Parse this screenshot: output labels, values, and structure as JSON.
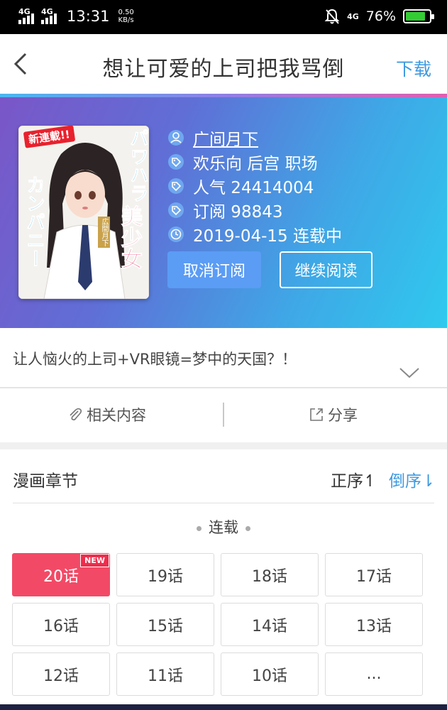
{
  "status": {
    "net1": "4G",
    "net2": "4G",
    "time": "13:31",
    "speed_value": "0.50",
    "speed_unit": "KB/s",
    "net3": "4G",
    "battery_pct": "76%",
    "battery_level": 0.76
  },
  "nav": {
    "title": "想让可爱的上司把我骂倒",
    "action": "下载"
  },
  "info": {
    "author": "广间月下",
    "tags": "欢乐向 后宫 职场",
    "popularity": "人气 24414004",
    "subscribe": "订阅 98843",
    "status_date": "2019-04-15 连载中"
  },
  "buttons": {
    "unsubscribe": "取消订阅",
    "continue": "继续阅读"
  },
  "description": "让人恼火的上司+VR眼镜=梦中的天国？！",
  "actions": {
    "related": "相关内容",
    "share": "分享"
  },
  "chapters": {
    "title": "漫画章节",
    "sort_asc": "正序↿",
    "sort_desc": "倒序⇂",
    "section": "连载",
    "new_badge": "NEW",
    "items": [
      "20话",
      "19话",
      "18话",
      "17话",
      "16话",
      "15话",
      "14话",
      "13话",
      "12话",
      "11话",
      "10话",
      "..."
    ]
  },
  "cover": {
    "banner": "新連載!!",
    "title_vertical_1": "パワハラ",
    "title_vertical_2": "カンパニー",
    "title_big": "美少女",
    "author_tag": "広間月下"
  },
  "colors": {
    "accent": "#3f9ae0",
    "active_chapter": "#f24a66",
    "new_badge": "#ee2d4c",
    "unsubscribe_btn": "#5b9cf5"
  },
  "icons": [
    "back-icon",
    "user-icon",
    "tag-icon",
    "clock-icon",
    "paperclip-icon",
    "share-icon",
    "chevron-down-icon",
    "no-notifications-icon",
    "battery-icon"
  ]
}
